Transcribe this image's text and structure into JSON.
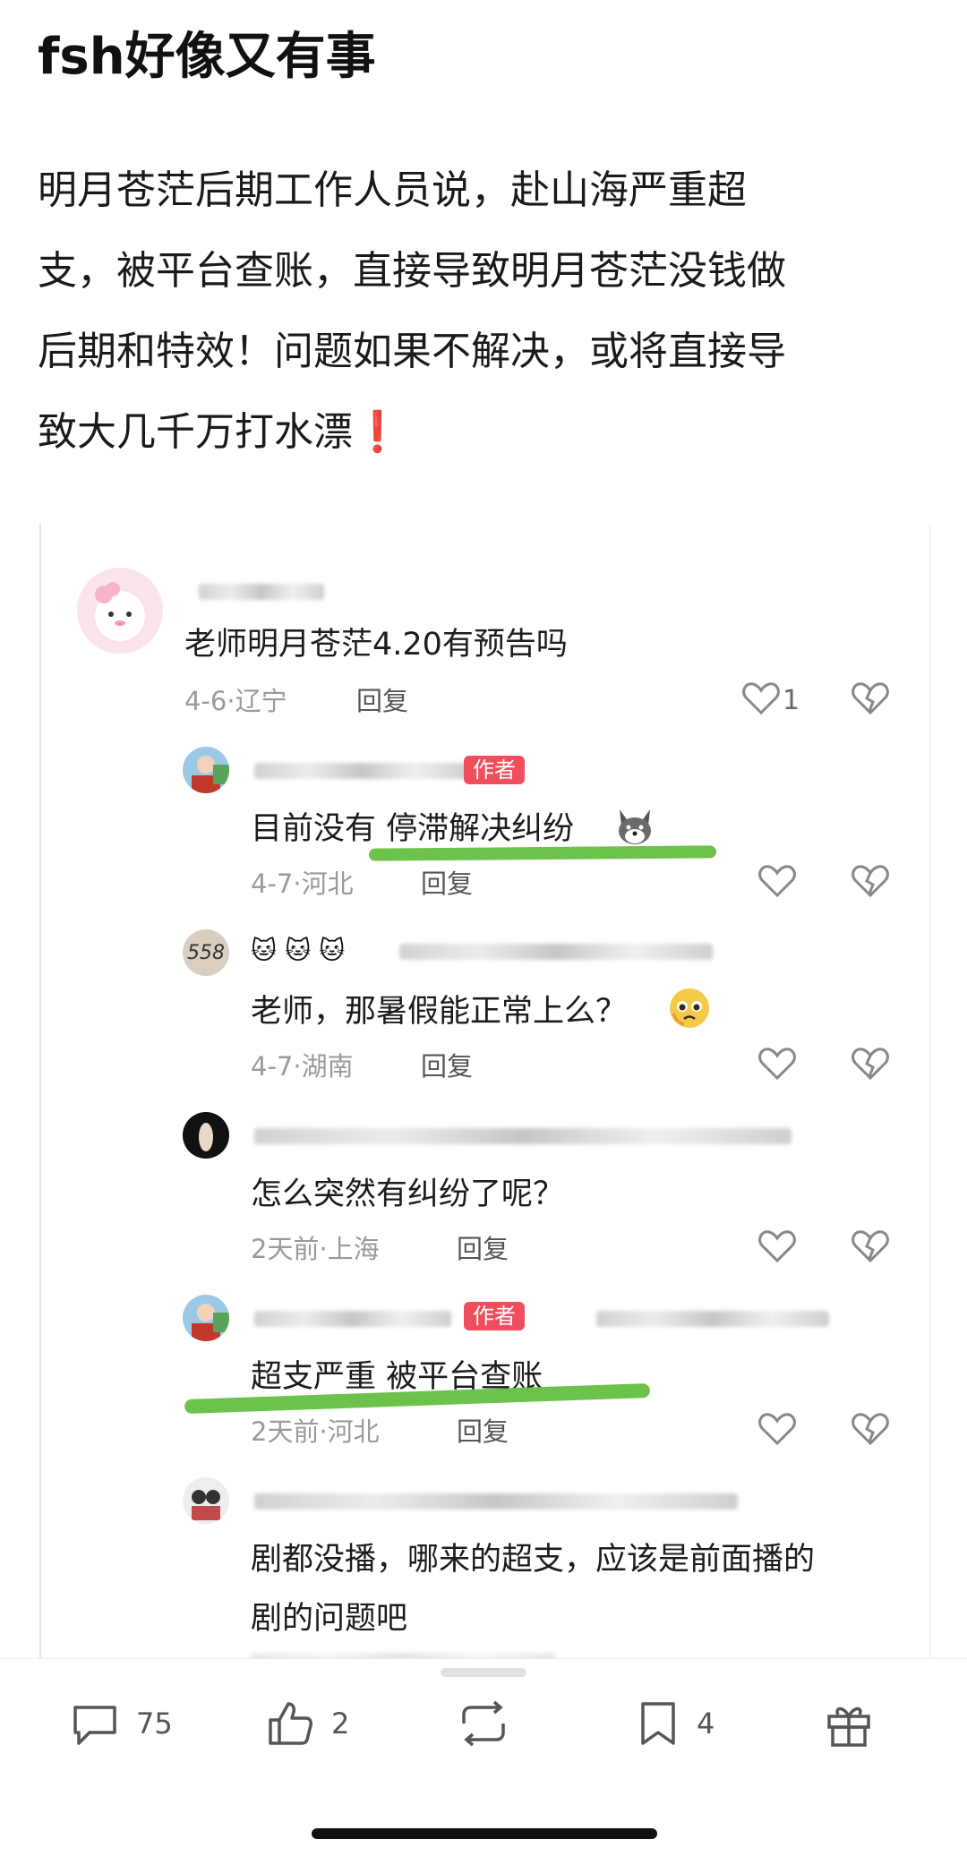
{
  "post": {
    "title": "fsh好像又有事",
    "body_lines": [
      "明月苍茫后期工作人员说，赴山海严重超",
      "支，被平台查账，直接导致明月苍茫没钱做",
      "后期和特效！问题如果不解决，或将直接导",
      "致大几千万打水漂"
    ],
    "body_end_mark": "❗"
  },
  "comments": [
    {
      "text": "老师明月苍茫4.20有预告吗",
      "meta": "4-6·辽宁",
      "reply": "回复",
      "likes": "1"
    },
    {
      "author_tag": "作者",
      "text": "目前没有  停滞解决纠纷",
      "meta": "4-7·河北",
      "reply": "回复",
      "emoji": "dog-emoji"
    },
    {
      "text": "老师，那暑假能正常上么？",
      "meta": "4-7·湖南",
      "reply": "回复",
      "name_prefix": "🐱 🐱 🐱",
      "avatar_text": "558",
      "emoji": "pleading-emoji"
    },
    {
      "text": "怎么突然有纠纷了呢？",
      "meta": "2天前·上海",
      "reply": "回复"
    },
    {
      "author_tag": "作者",
      "text": "超支严重 被平台查账",
      "meta": "2天前·河北",
      "reply": "回复"
    },
    {
      "text_lines": [
        "剧都没播，哪来的超支，应该是前面播的",
        "剧的问题吧"
      ]
    }
  ],
  "toolbar": {
    "comment_count": "75",
    "like_count": "2",
    "bookmark_count": "4"
  },
  "icons": [
    "heart-icon",
    "broken-heart-icon",
    "comment-icon",
    "thumbs-up-icon",
    "repost-icon",
    "bookmark-icon",
    "gift-icon"
  ],
  "colors": {
    "author_tag": "#f04d5d",
    "highlight": "#6cc24a",
    "exclamation": "#e31b23"
  }
}
